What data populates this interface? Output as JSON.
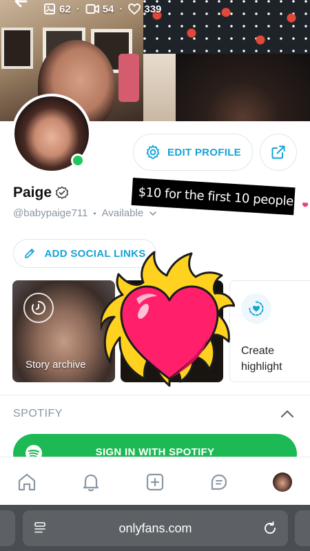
{
  "stats": {
    "photos": "62",
    "videos": "54",
    "likes": "339"
  },
  "profile": {
    "name": "Paige",
    "handle": "@babypaige711",
    "status": "Available",
    "edit_label": "EDIT PROFILE",
    "social_label": "ADD SOCIAL LINKS"
  },
  "promo": {
    "text": "$10 for the first 10 people"
  },
  "stories": {
    "archive_label": "Story archive",
    "create_label": "Create highlight"
  },
  "spotify": {
    "section_title": "SPOTIFY",
    "sign_in_label": "SIGN IN WITH SPOTIFY"
  },
  "browser": {
    "url": "onlyfans.com"
  },
  "colors": {
    "accent": "#16a3d6",
    "online": "#22c55e",
    "spotify": "#1db954",
    "heart": "#ff1f6b",
    "flame": "#ffd21f"
  },
  "icons": {
    "back": "arrow-left-icon",
    "more": "more-vertical-icon",
    "photos": "image-icon",
    "videos": "video-icon",
    "likes": "heart-icon",
    "edit": "gear-icon",
    "share": "share-icon",
    "verified": "verified-badge-icon",
    "social": "pencil-icon",
    "archive": "clock-icon",
    "create": "add-highlight-icon",
    "collapse": "chevron-up-icon",
    "nav": [
      "home-icon",
      "bell-icon",
      "plus-square-icon",
      "message-icon",
      "profile-avatar"
    ]
  }
}
